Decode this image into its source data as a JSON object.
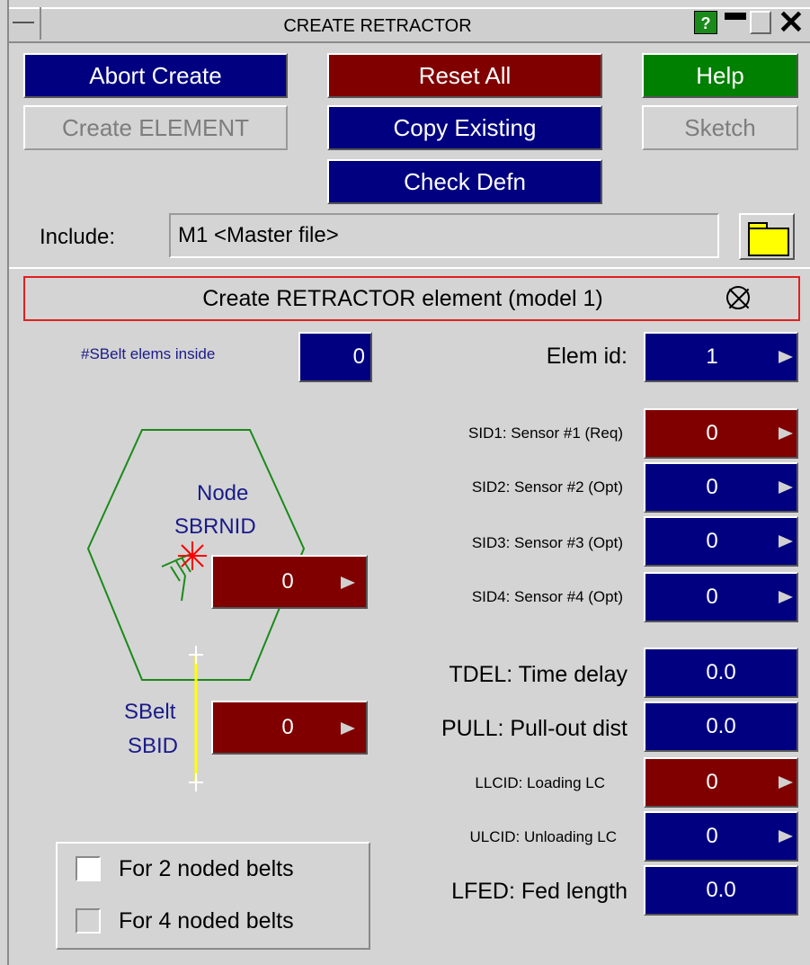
{
  "window": {
    "title": "CREATE RETRACTOR",
    "help_glyph": "?"
  },
  "buttons": {
    "abort": "Abort Create",
    "reset": "Reset All",
    "help": "Help",
    "create_element": "Create ELEMENT",
    "copy_existing": "Copy Existing",
    "sketch": "Sketch",
    "check_defn": "Check Defn"
  },
  "include": {
    "label": "Include:",
    "value": "M1  <Master file>"
  },
  "panel": {
    "heading": "Create RETRACTOR element (model 1)"
  },
  "fields": {
    "sbelt_elems_inside": {
      "label": "#SBelt elems inside",
      "value": "0"
    },
    "elem_id": {
      "label": "Elem id:",
      "value": "1"
    },
    "sid1": {
      "label": "SID1: Sensor #1 (Req)",
      "value": "0"
    },
    "sid2": {
      "label": "SID2: Sensor #2 (Opt)",
      "value": "0"
    },
    "sid3": {
      "label": "SID3: Sensor #3 (Opt)",
      "value": "0"
    },
    "sid4": {
      "label": "SID4: Sensor #4 (Opt)",
      "value": "0"
    },
    "tdel": {
      "label": "TDEL: Time delay",
      "value": "0.0"
    },
    "pull": {
      "label": "PULL: Pull-out dist",
      "value": "0.0"
    },
    "llcid": {
      "label": "LLCID: Loading LC",
      "value": "0"
    },
    "ulcid": {
      "label": "ULCID: Unloading LC",
      "value": "0"
    },
    "lfed": {
      "label": "LFED: Fed length",
      "value": "0.0"
    }
  },
  "diagram": {
    "node_label_1": "Node",
    "node_label_2": "SBRNID",
    "node_value": "0",
    "sbelt_label_1": "SBelt",
    "sbelt_label_2": "SBID",
    "sbelt_value": "0"
  },
  "options": {
    "two_noded": "For 2 noded belts",
    "four_noded": "For 4 noded belts"
  },
  "colors": {
    "blue": "#000080",
    "red": "#800000",
    "green": "#008000",
    "hexagon": "#1a8a1a",
    "belt": "#ffff00",
    "node_marker": "#ff0000"
  }
}
